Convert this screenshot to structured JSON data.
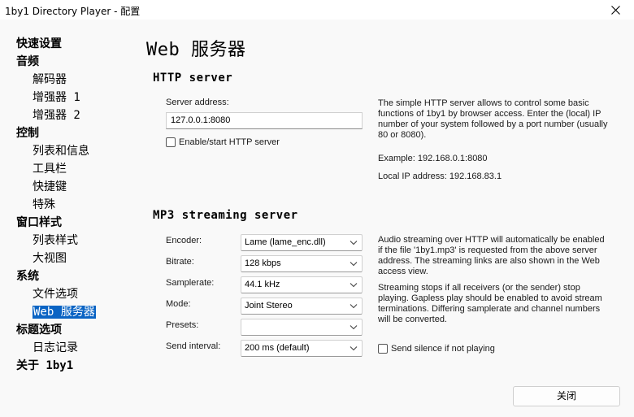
{
  "window": {
    "title": "1by1 Directory Player - 配置"
  },
  "sidebar": {
    "items": [
      {
        "label": "快速设置",
        "level": 0
      },
      {
        "label": "音频",
        "level": 0
      },
      {
        "label": "解码器",
        "level": 1
      },
      {
        "label": "增强器 1",
        "level": 1
      },
      {
        "label": "增强器 2",
        "level": 1
      },
      {
        "label": "控制",
        "level": 0
      },
      {
        "label": "列表和信息",
        "level": 1
      },
      {
        "label": "工具栏",
        "level": 1
      },
      {
        "label": "快捷键",
        "level": 1
      },
      {
        "label": "特殊",
        "level": 1
      },
      {
        "label": "窗口样式",
        "level": 0
      },
      {
        "label": "列表样式",
        "level": 1
      },
      {
        "label": "大视图",
        "level": 1
      },
      {
        "label": "系统",
        "level": 0
      },
      {
        "label": "文件选项",
        "level": 1
      },
      {
        "label": "Web 服务器",
        "level": 1,
        "selected": true
      },
      {
        "label": "标题选项",
        "level": 0
      },
      {
        "label": "日志记录",
        "level": 1
      },
      {
        "label": "关于 1by1",
        "level": 0
      }
    ]
  },
  "page": {
    "title": "Web 服务器"
  },
  "http": {
    "section_title": "HTTP server",
    "address_label": "Server address:",
    "address_value": "127.0.0.1:8080",
    "enable_label": "Enable/start HTTP server",
    "enable_checked": false,
    "desc_lines": [
      "The simple HTTP server allows to control some basic",
      "functions of 1by1 by browser access. Enter the (local) IP",
      "number of your system followed by a port number (usually",
      "80 or 8080)."
    ],
    "example": "Example: 192.168.0.1:8080",
    "local_ip": "Local IP address: 192.168.83.1"
  },
  "mp3": {
    "section_title": "MP3 streaming server",
    "encoder_label": "Encoder:",
    "encoder_value": "Lame (lame_enc.dll)",
    "bitrate_label": "Bitrate:",
    "bitrate_value": "128 kbps",
    "samplerate_label": "Samplerate:",
    "samplerate_value": "44.1 kHz",
    "mode_label": "Mode:",
    "mode_value": "Joint Stereo",
    "presets_label": "Presets:",
    "presets_value": "",
    "interval_label": "Send interval:",
    "interval_value": "200 ms (default)",
    "desc1_lines": [
      "Audio streaming over HTTP will automatically be enabled",
      "if the file '1by1.mp3' is requested from the above server",
      "address. The streaming links are also shown in the Web",
      "access view."
    ],
    "desc2_lines": [
      "Streaming stops if all receivers (or the sender) stop",
      "playing. Gapless play should be enabled to avoid stream",
      "terminations. Differing samplerate and channel numbers",
      "will be converted."
    ],
    "silence_label": "Send silence if not playing",
    "silence_checked": false
  },
  "footer": {
    "close_label": "关闭"
  }
}
